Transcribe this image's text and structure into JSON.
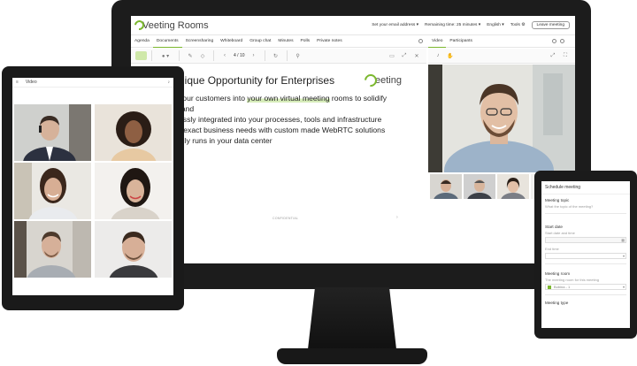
{
  "app": {
    "name": "Veeting Rooms",
    "email_menu": "Set your email address ▾",
    "remaining": "Remaining time: 25 minutes ▾",
    "language": "English ▾",
    "tools": "Tools ⚙",
    "leave": "Leave meeting"
  },
  "tabs": [
    "Agenda",
    "Documents",
    "Screensharing",
    "Whiteboard",
    "Group chat",
    "Minutes",
    "Polls",
    "Private notes"
  ],
  "video_tabs": [
    "Video",
    "Participants"
  ],
  "toolbar": {
    "page": "4 / 10"
  },
  "slide": {
    "title": "nique Opportunity for Enterprises",
    "logo": "eeting",
    "bullet_1a": " your customers into ",
    "bullet_1b": "your own virtual meeting",
    "bullet_1c": " rooms to solidify",
    "bullet_1d": "rand",
    "bullet_2": "essly integrated into your processes, tools and infrastructure",
    "bullet_3": "r exact business needs with custom made WebRTC solutions",
    "bullet_4": "ally runs in your data center",
    "footer": "CONFIDENTIAL",
    "next": "›"
  },
  "tablet": {
    "title": "Video"
  },
  "phone": {
    "title": "Schedule meeting",
    "topic_label": "Meeting topic",
    "topic_hint": "What the topic of the meeting?",
    "start_label": "Start date",
    "start_hint": "Start date and time",
    "end_label": "End time",
    "room_label": "Meeting room",
    "room_hint": "The meeting room for this meeting",
    "room_value": "Bobina - 1",
    "type_label": "Meeting type"
  },
  "colors": {
    "accent": "#7cb82f",
    "frame": "#1c1c1c"
  }
}
